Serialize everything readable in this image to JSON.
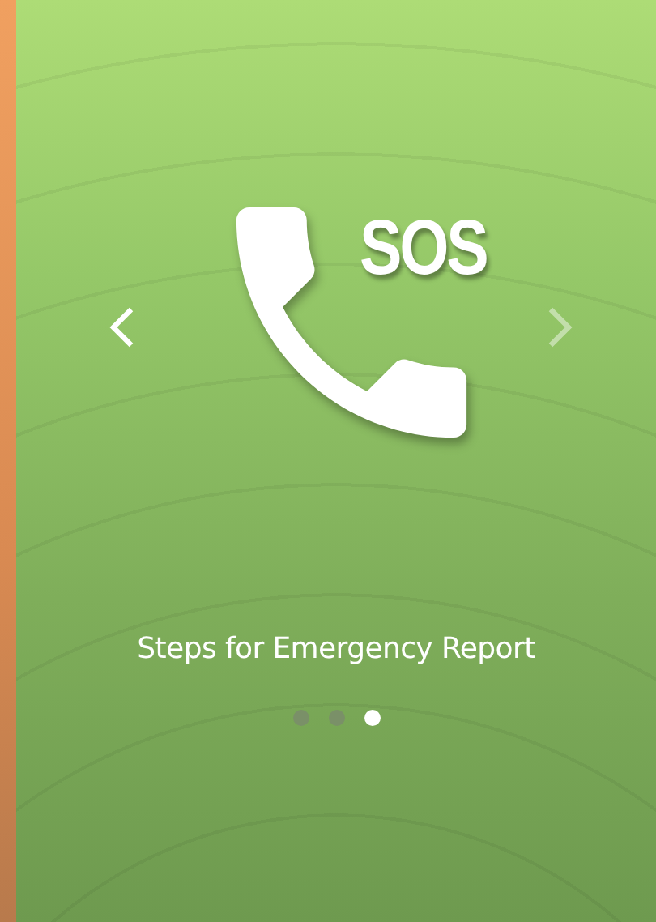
{
  "slide": {
    "title": "SOS",
    "caption": "Steps for Emergency Report"
  },
  "nav": {
    "prev": {
      "disabled": false
    },
    "next": {
      "disabled": true
    }
  },
  "dots": [
    {
      "selected": false
    },
    {
      "selected": false
    },
    {
      "selected": true
    }
  ]
}
